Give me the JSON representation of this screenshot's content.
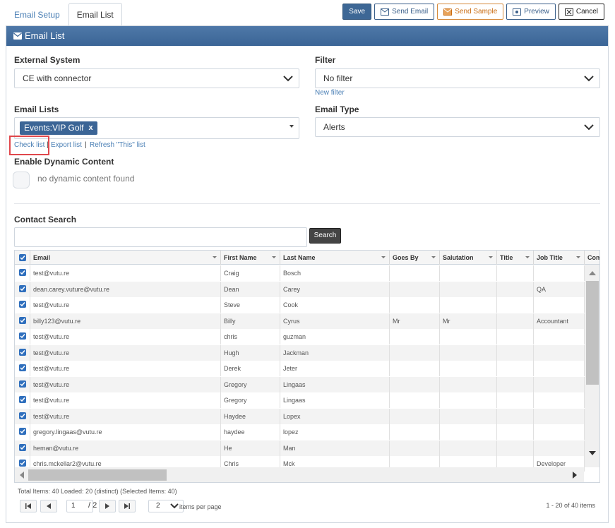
{
  "tabs": [
    {
      "label": "Email Setup",
      "active": false
    },
    {
      "label": "Email List",
      "active": true
    }
  ],
  "toolbar": {
    "save": "Save",
    "send_email": "Send Email",
    "send_sample": "Send Sample",
    "preview": "Preview",
    "cancel": "Cancel"
  },
  "panel": {
    "title": "Email List"
  },
  "form": {
    "external_system_label": "External System",
    "external_system_value": "CE with connector",
    "filter_label": "Filter",
    "filter_value": "No filter",
    "new_filter": "New filter",
    "email_lists_label": "Email Lists",
    "email_list_tag": "Events:VIP Golf",
    "email_list_tag_remove": "x",
    "email_type_label": "Email Type",
    "email_type_value": "Alerts",
    "check_list": "Check list",
    "export_list": "Export list",
    "refresh_list": "Refresh \"This\" list",
    "link_separator": "|",
    "dynamic_label": "Enable Dynamic Content",
    "dynamic_note": "no dynamic content found",
    "contact_search_label": "Contact Search",
    "search_button": "Search"
  },
  "grid": {
    "columns": [
      "Email",
      "First Name",
      "Last Name",
      "Goes By",
      "Salutation",
      "Title",
      "Job Title",
      "Com"
    ],
    "rows": [
      [
        "test@vutu.re",
        "Craig",
        "Bosch",
        "",
        "",
        "",
        ""
      ],
      [
        "dean.carey.vuture@vutu.re",
        "Dean",
        "Carey",
        "",
        "",
        "",
        "QA"
      ],
      [
        "test@vutu.re",
        "Steve",
        "Cook",
        "",
        "",
        "",
        ""
      ],
      [
        "billy123@vutu.re",
        "Billy",
        "Cyrus",
        "Mr",
        "Mr",
        "",
        "Accountant"
      ],
      [
        "test@vutu.re",
        "chris",
        "guzman",
        "",
        "",
        "",
        ""
      ],
      [
        "test@vutu.re",
        "Hugh",
        "Jackman",
        "",
        "",
        "",
        ""
      ],
      [
        "test@vutu.re",
        "Derek",
        "Jeter",
        "",
        "",
        "",
        ""
      ],
      [
        "test@vutu.re",
        "Gregory",
        "Lingaas",
        "",
        "",
        "",
        ""
      ],
      [
        "test@vutu.re",
        "Gregory",
        "Lingaas",
        "",
        "",
        "",
        ""
      ],
      [
        "test@vutu.re",
        "Haydee",
        "Lopex",
        "",
        "",
        "",
        ""
      ],
      [
        "gregory.lingaas@vutu.re",
        "haydee",
        "lopez",
        "",
        "",
        "",
        ""
      ],
      [
        "heman@vutu.re",
        "He",
        "Man",
        "",
        "",
        "",
        ""
      ],
      [
        "chris.mckellar2@vutu.re",
        "Chris",
        "Mck",
        "",
        "",
        "",
        "Developer"
      ]
    ]
  },
  "footer": {
    "totals": "Total Items: 40 Loaded: 20 (distinct) (Selected Items: 40)",
    "page_value": "1",
    "page_total": "/ 2",
    "page_size": "2",
    "items_per_page": "items per page",
    "range": "1 - 20 of 40 items"
  },
  "colors": {
    "header_blue": "#3b6596",
    "link_blue": "#4a7fb5",
    "highlight_red": "#e0474c",
    "sample_orange": "#c96c12"
  },
  "icons": [
    "envelope-icon",
    "send-icon",
    "preview-icon",
    "cancel-icon",
    "chevron-down-icon",
    "first-page-icon",
    "prev-page-icon",
    "next-page-icon",
    "last-page-icon"
  ]
}
